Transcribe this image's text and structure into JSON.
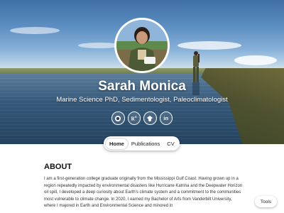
{
  "profile": {
    "name": "Sarah Monica",
    "subtitle": "Marine Science PhD, Sedimentologist, Paleoclimatologist"
  },
  "socials": [
    {
      "icon": "github-icon"
    },
    {
      "icon": "researchgate-icon"
    },
    {
      "icon": "google-scholar-icon"
    },
    {
      "icon": "linkedin-icon"
    }
  ],
  "nav": {
    "items": [
      "Home",
      "Publications",
      "CV"
    ],
    "active": "Home"
  },
  "about": {
    "heading": "ABOUT",
    "text": "I am a first-generation college graduate originally from the Mississippi Gulf Coast. Having grown up in a region repeatedly impacted by environmental disasters like Hurricane Katrina and the Deepwater Horizon oil spill, I developed a deep curiosity about Earth's climate system and a commitment to the communities most vulnerable to climate change. In 2020, I earned my Bachelor of Arts from Vanderbilt University, where I majored in Earth and Environmental Science and minored in"
  },
  "tools": {
    "label": "Tools"
  },
  "colors": {
    "accent_text": "#ffffff",
    "sky": "#5c8ec2",
    "water": "#23425f"
  }
}
